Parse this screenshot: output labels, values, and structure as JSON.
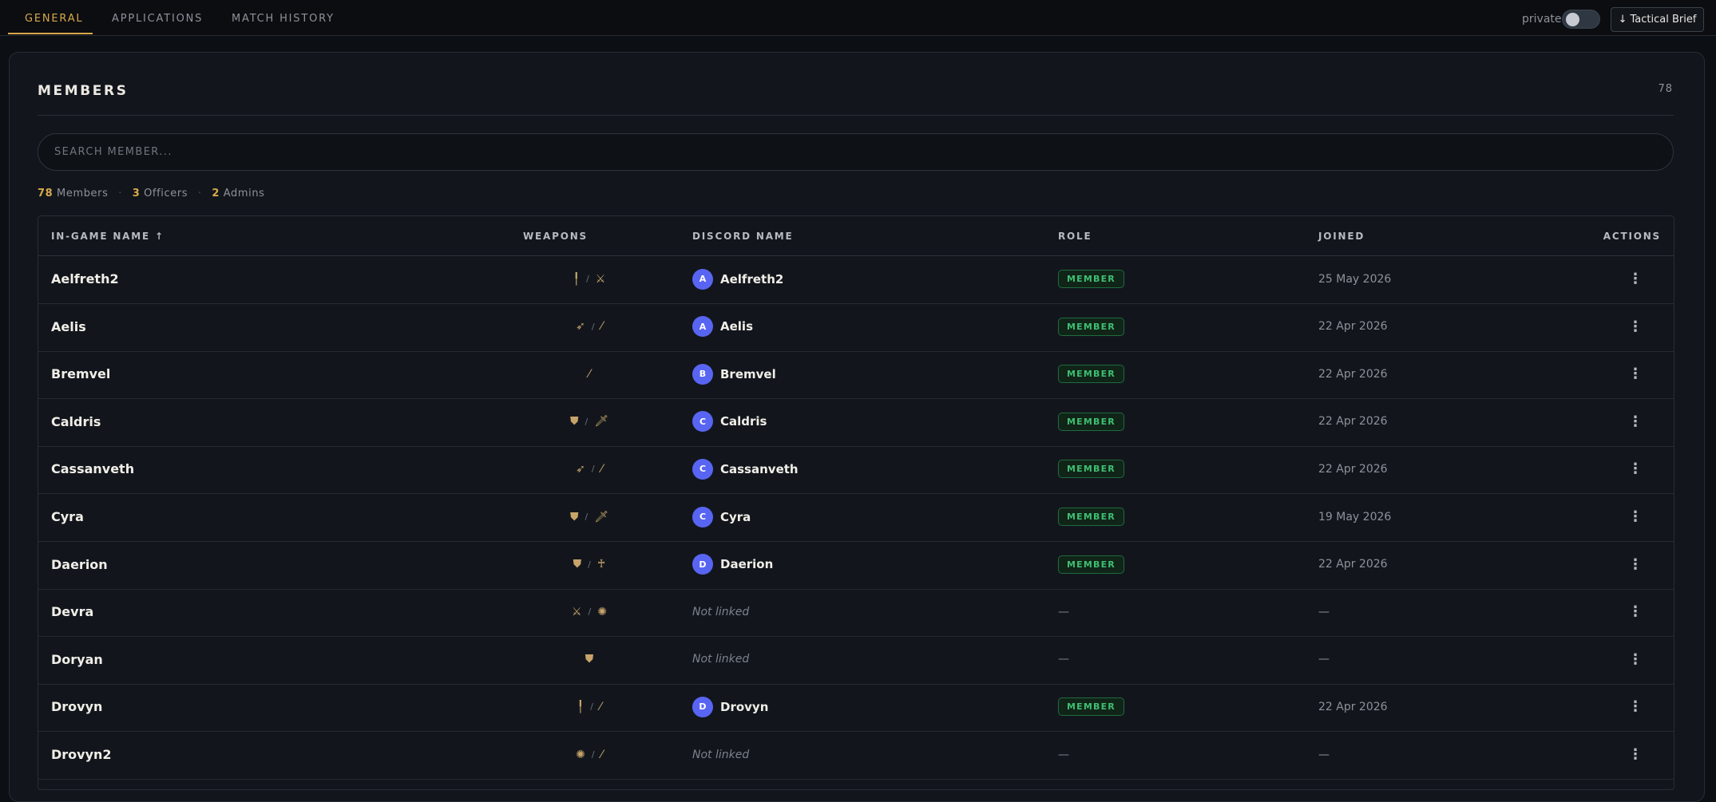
{
  "tabs": [
    {
      "label": "GENERAL",
      "active": true
    },
    {
      "label": "APPLICATIONS",
      "active": false
    },
    {
      "label": "MATCH HISTORY",
      "active": false
    }
  ],
  "header": {
    "private_label": "private",
    "private_enabled": false,
    "brief_button_label": "Tactical Brief",
    "brief_button_icon": "download-arrow-icon",
    "brief_button_glyph": "↓"
  },
  "members": {
    "title": "MEMBERS",
    "count": "78",
    "search_placeholder": "SEARCH MEMBER...",
    "stats": {
      "members_count": "78",
      "members_label": "Members",
      "officers_count": "3",
      "officers_label": "Officers",
      "admins_count": "2",
      "admins_label": "Admins",
      "separator": "·"
    },
    "columns": {
      "ign": "IN-GAME NAME",
      "sort_indicator": "↑",
      "weapons": "WEAPONS",
      "discord": "DISCORD NAME",
      "role": "ROLE",
      "joined": "JOINED",
      "actions": "ACTIONS"
    },
    "not_linked_text": "Not linked",
    "empty_dash": "—",
    "actions_glyph": "⋮",
    "rows": [
      {
        "ign": "Aelfreth2",
        "weapons": [
          {
            "icon": "spear-icon",
            "glyph": "╿"
          },
          {
            "icon": "crossed-swords-icon",
            "glyph": "⚔"
          }
        ],
        "discord": "Aelfreth2",
        "avatar": "A",
        "linked": true,
        "role": "MEMBER",
        "joined": "25 May 2026"
      },
      {
        "ign": "Aelis",
        "weapons": [
          {
            "icon": "bow-icon",
            "glyph": "➶"
          },
          {
            "icon": "staff-icon",
            "glyph": "⁄"
          }
        ],
        "discord": "Aelis",
        "avatar": "A",
        "linked": true,
        "role": "MEMBER",
        "joined": "22 Apr 2026"
      },
      {
        "ign": "Bremvel",
        "weapons": [
          {
            "icon": "staff-icon",
            "glyph": "⁄"
          }
        ],
        "discord": "Bremvel",
        "avatar": "B",
        "linked": true,
        "role": "MEMBER",
        "joined": "22 Apr 2026"
      },
      {
        "ign": "Caldris",
        "weapons": [
          {
            "icon": "shield-icon",
            "glyph": "⛊"
          },
          {
            "icon": "sword-icon",
            "glyph": "🗡"
          }
        ],
        "discord": "Caldris",
        "avatar": "C",
        "linked": true,
        "role": "MEMBER",
        "joined": "22 Apr 2026"
      },
      {
        "ign": "Cassanveth",
        "weapons": [
          {
            "icon": "bow-icon",
            "glyph": "➶"
          },
          {
            "icon": "staff-icon",
            "glyph": "⁄"
          }
        ],
        "discord": "Cassanveth",
        "avatar": "C",
        "linked": true,
        "role": "MEMBER",
        "joined": "22 Apr 2026"
      },
      {
        "ign": "Cyra",
        "weapons": [
          {
            "icon": "shield-icon",
            "glyph": "⛊"
          },
          {
            "icon": "sword-icon",
            "glyph": "🗡"
          }
        ],
        "discord": "Cyra",
        "avatar": "C",
        "linked": true,
        "role": "MEMBER",
        "joined": "19 May 2026"
      },
      {
        "ign": "Daerion",
        "weapons": [
          {
            "icon": "shield-icon",
            "glyph": "⛊"
          },
          {
            "icon": "mace-icon",
            "glyph": "♰"
          }
        ],
        "discord": "Daerion",
        "avatar": "D",
        "linked": true,
        "role": "MEMBER",
        "joined": "22 Apr 2026"
      },
      {
        "ign": "Devra",
        "weapons": [
          {
            "icon": "crossed-swords-icon",
            "glyph": "⚔"
          },
          {
            "icon": "orb-icon",
            "glyph": "✺"
          }
        ],
        "discord": "",
        "avatar": "",
        "linked": false,
        "role": "—",
        "joined": "—"
      },
      {
        "ign": "Doryan",
        "weapons": [
          {
            "icon": "shield-icon",
            "glyph": "⛊"
          }
        ],
        "discord": "",
        "avatar": "",
        "linked": false,
        "role": "—",
        "joined": "—"
      },
      {
        "ign": "Drovyn",
        "weapons": [
          {
            "icon": "spear-icon",
            "glyph": "╿"
          },
          {
            "icon": "staff-icon",
            "glyph": "⁄"
          }
        ],
        "discord": "Drovyn",
        "avatar": "D",
        "linked": true,
        "role": "MEMBER",
        "joined": "22 Apr 2026"
      },
      {
        "ign": "Drovyn2",
        "weapons": [
          {
            "icon": "orb-icon",
            "glyph": "✺"
          },
          {
            "icon": "staff-icon",
            "glyph": "⁄"
          }
        ],
        "discord": "",
        "avatar": "",
        "linked": false,
        "role": "—",
        "joined": "—"
      }
    ]
  },
  "colors": {
    "accent": "#d9a94a",
    "background": "#0c0f13",
    "card": "#12161c",
    "avatar": "#5865f2",
    "badge_text": "#3fbf72",
    "badge_border": "#1f6b3f"
  }
}
